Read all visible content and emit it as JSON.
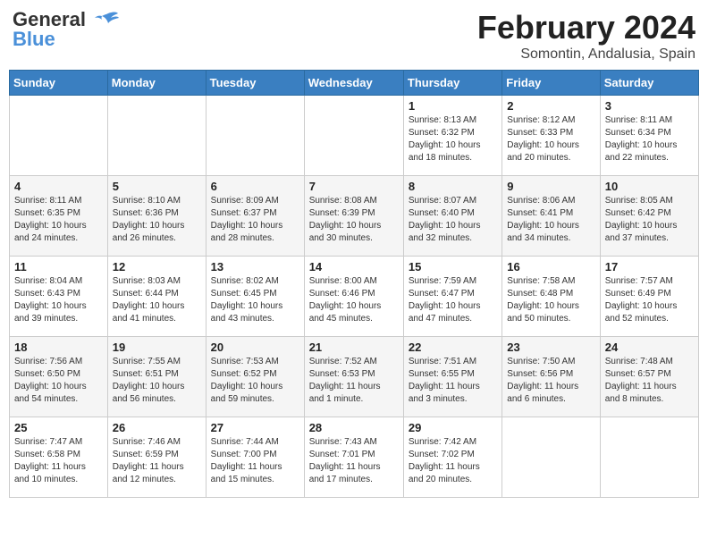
{
  "header": {
    "logo_line1": "General",
    "logo_line2": "Blue",
    "month_title": "February 2024",
    "location": "Somontin, Andalusia, Spain"
  },
  "weekdays": [
    "Sunday",
    "Monday",
    "Tuesday",
    "Wednesday",
    "Thursday",
    "Friday",
    "Saturday"
  ],
  "weeks": [
    [
      {
        "day": "",
        "info": ""
      },
      {
        "day": "",
        "info": ""
      },
      {
        "day": "",
        "info": ""
      },
      {
        "day": "",
        "info": ""
      },
      {
        "day": "1",
        "info": "Sunrise: 8:13 AM\nSunset: 6:32 PM\nDaylight: 10 hours\nand 18 minutes."
      },
      {
        "day": "2",
        "info": "Sunrise: 8:12 AM\nSunset: 6:33 PM\nDaylight: 10 hours\nand 20 minutes."
      },
      {
        "day": "3",
        "info": "Sunrise: 8:11 AM\nSunset: 6:34 PM\nDaylight: 10 hours\nand 22 minutes."
      }
    ],
    [
      {
        "day": "4",
        "info": "Sunrise: 8:11 AM\nSunset: 6:35 PM\nDaylight: 10 hours\nand 24 minutes."
      },
      {
        "day": "5",
        "info": "Sunrise: 8:10 AM\nSunset: 6:36 PM\nDaylight: 10 hours\nand 26 minutes."
      },
      {
        "day": "6",
        "info": "Sunrise: 8:09 AM\nSunset: 6:37 PM\nDaylight: 10 hours\nand 28 minutes."
      },
      {
        "day": "7",
        "info": "Sunrise: 8:08 AM\nSunset: 6:39 PM\nDaylight: 10 hours\nand 30 minutes."
      },
      {
        "day": "8",
        "info": "Sunrise: 8:07 AM\nSunset: 6:40 PM\nDaylight: 10 hours\nand 32 minutes."
      },
      {
        "day": "9",
        "info": "Sunrise: 8:06 AM\nSunset: 6:41 PM\nDaylight: 10 hours\nand 34 minutes."
      },
      {
        "day": "10",
        "info": "Sunrise: 8:05 AM\nSunset: 6:42 PM\nDaylight: 10 hours\nand 37 minutes."
      }
    ],
    [
      {
        "day": "11",
        "info": "Sunrise: 8:04 AM\nSunset: 6:43 PM\nDaylight: 10 hours\nand 39 minutes."
      },
      {
        "day": "12",
        "info": "Sunrise: 8:03 AM\nSunset: 6:44 PM\nDaylight: 10 hours\nand 41 minutes."
      },
      {
        "day": "13",
        "info": "Sunrise: 8:02 AM\nSunset: 6:45 PM\nDaylight: 10 hours\nand 43 minutes."
      },
      {
        "day": "14",
        "info": "Sunrise: 8:00 AM\nSunset: 6:46 PM\nDaylight: 10 hours\nand 45 minutes."
      },
      {
        "day": "15",
        "info": "Sunrise: 7:59 AM\nSunset: 6:47 PM\nDaylight: 10 hours\nand 47 minutes."
      },
      {
        "day": "16",
        "info": "Sunrise: 7:58 AM\nSunset: 6:48 PM\nDaylight: 10 hours\nand 50 minutes."
      },
      {
        "day": "17",
        "info": "Sunrise: 7:57 AM\nSunset: 6:49 PM\nDaylight: 10 hours\nand 52 minutes."
      }
    ],
    [
      {
        "day": "18",
        "info": "Sunrise: 7:56 AM\nSunset: 6:50 PM\nDaylight: 10 hours\nand 54 minutes."
      },
      {
        "day": "19",
        "info": "Sunrise: 7:55 AM\nSunset: 6:51 PM\nDaylight: 10 hours\nand 56 minutes."
      },
      {
        "day": "20",
        "info": "Sunrise: 7:53 AM\nSunset: 6:52 PM\nDaylight: 10 hours\nand 59 minutes."
      },
      {
        "day": "21",
        "info": "Sunrise: 7:52 AM\nSunset: 6:53 PM\nDaylight: 11 hours\nand 1 minute."
      },
      {
        "day": "22",
        "info": "Sunrise: 7:51 AM\nSunset: 6:55 PM\nDaylight: 11 hours\nand 3 minutes."
      },
      {
        "day": "23",
        "info": "Sunrise: 7:50 AM\nSunset: 6:56 PM\nDaylight: 11 hours\nand 6 minutes."
      },
      {
        "day": "24",
        "info": "Sunrise: 7:48 AM\nSunset: 6:57 PM\nDaylight: 11 hours\nand 8 minutes."
      }
    ],
    [
      {
        "day": "25",
        "info": "Sunrise: 7:47 AM\nSunset: 6:58 PM\nDaylight: 11 hours\nand 10 minutes."
      },
      {
        "day": "26",
        "info": "Sunrise: 7:46 AM\nSunset: 6:59 PM\nDaylight: 11 hours\nand 12 minutes."
      },
      {
        "day": "27",
        "info": "Sunrise: 7:44 AM\nSunset: 7:00 PM\nDaylight: 11 hours\nand 15 minutes."
      },
      {
        "day": "28",
        "info": "Sunrise: 7:43 AM\nSunset: 7:01 PM\nDaylight: 11 hours\nand 17 minutes."
      },
      {
        "day": "29",
        "info": "Sunrise: 7:42 AM\nSunset: 7:02 PM\nDaylight: 11 hours\nand 20 minutes."
      },
      {
        "day": "",
        "info": ""
      },
      {
        "day": "",
        "info": ""
      }
    ]
  ]
}
